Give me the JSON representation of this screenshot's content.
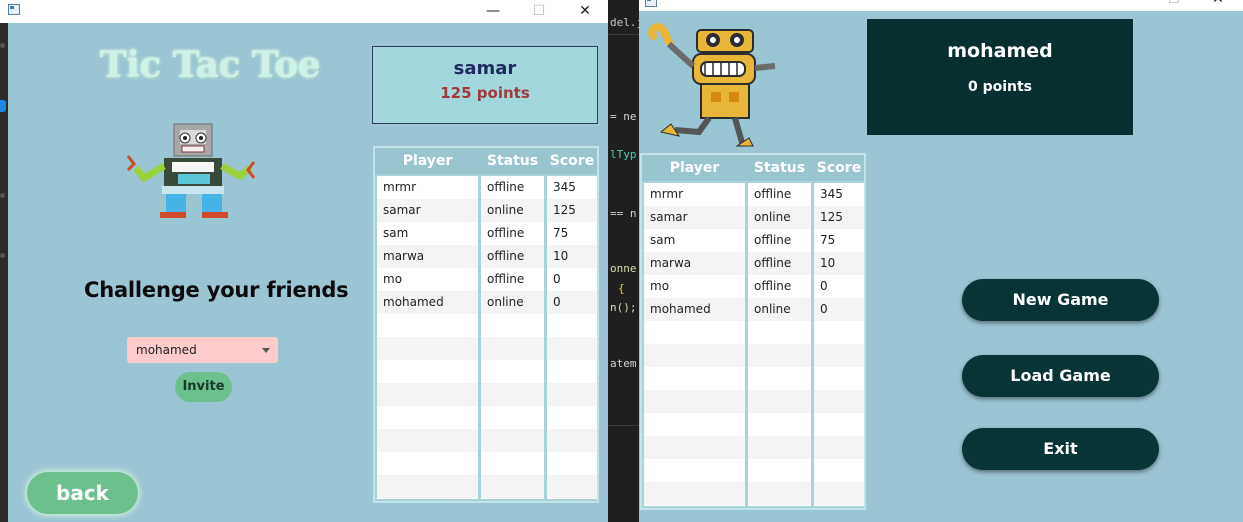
{
  "left_window": {
    "title_controls": {
      "minimize": "—",
      "maximize": "☐",
      "close": "✕"
    },
    "app_title": "Tic Tac Toe",
    "challenge_text": "Challenge your friends",
    "friend_select": {
      "value": "mohamed"
    },
    "invite_label": "Invite",
    "back_label": "back",
    "profile": {
      "name": "samar",
      "points": "125 points"
    },
    "table": {
      "headers": [
        "Player",
        "Status",
        "Score"
      ],
      "rows": [
        [
          "mrmr",
          "offline",
          "345"
        ],
        [
          "samar",
          "online",
          "125"
        ],
        [
          "sam",
          "offline",
          "75"
        ],
        [
          "marwa",
          "offline",
          "10"
        ],
        [
          "mo",
          "offline",
          "0"
        ],
        [
          "mohamed",
          "online",
          "0"
        ]
      ]
    }
  },
  "right_window": {
    "title_controls": {
      "minimize": "—",
      "maximize": "☐",
      "close": "✕"
    },
    "profile": {
      "name": "mohamed",
      "points": "0 points"
    },
    "table": {
      "headers": [
        "Player",
        "Status",
        "Score"
      ],
      "rows": [
        [
          "mrmr",
          "offline",
          "345"
        ],
        [
          "samar",
          "online",
          "125"
        ],
        [
          "sam",
          "offline",
          "75"
        ],
        [
          "marwa",
          "offline",
          "10"
        ],
        [
          "mo",
          "offline",
          "0"
        ],
        [
          "mohamed",
          "online",
          "0"
        ]
      ]
    },
    "buttons": {
      "new_game": "New Game",
      "load_game": "Load Game",
      "exit": "Exit"
    }
  },
  "code_fragments": {
    "l1": "del.ja",
    "l2": "= ne",
    "l3": "lTyp",
    "l4": "== n",
    "l5": "onne",
    "l6": "{",
    "l7": "n();",
    "l8": "atem"
  }
}
